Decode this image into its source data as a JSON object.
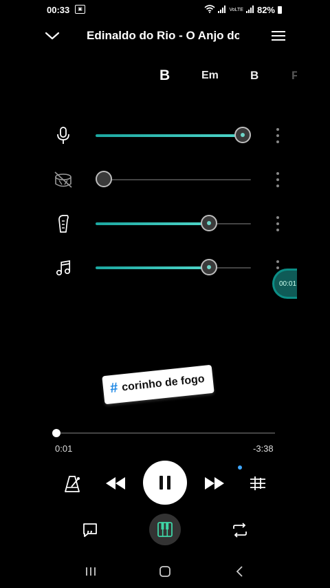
{
  "status": {
    "time": "00:33",
    "network": "VoLTE",
    "battery": "82%"
  },
  "header": {
    "title": "Edinaldo do Rio - O Anjo do"
  },
  "chords": [
    {
      "label": "B",
      "active": true
    },
    {
      "label": "Em",
      "active": false
    },
    {
      "label": "B",
      "active": false
    },
    {
      "label": "F",
      "active": false
    }
  ],
  "tracks": [
    {
      "name": "vocals",
      "icon": "microphone-icon",
      "level": 0.95,
      "muted": false
    },
    {
      "name": "drums",
      "icon": "drum-muted-icon",
      "level": 0.0,
      "muted": true
    },
    {
      "name": "guitar",
      "icon": "guitar-icon",
      "level": 0.73,
      "muted": false
    },
    {
      "name": "other",
      "icon": "music-note-icon",
      "level": 0.73,
      "muted": false
    }
  ],
  "floating": {
    "text": "00:01"
  },
  "tag": {
    "text": "corinho de fogo"
  },
  "player": {
    "elapsed": "0:01",
    "remaining": "-3:38",
    "progress": 0.005
  },
  "colors": {
    "accent": "#4fd6c9",
    "accent_dark": "#0c8e86",
    "background": "#000000"
  }
}
